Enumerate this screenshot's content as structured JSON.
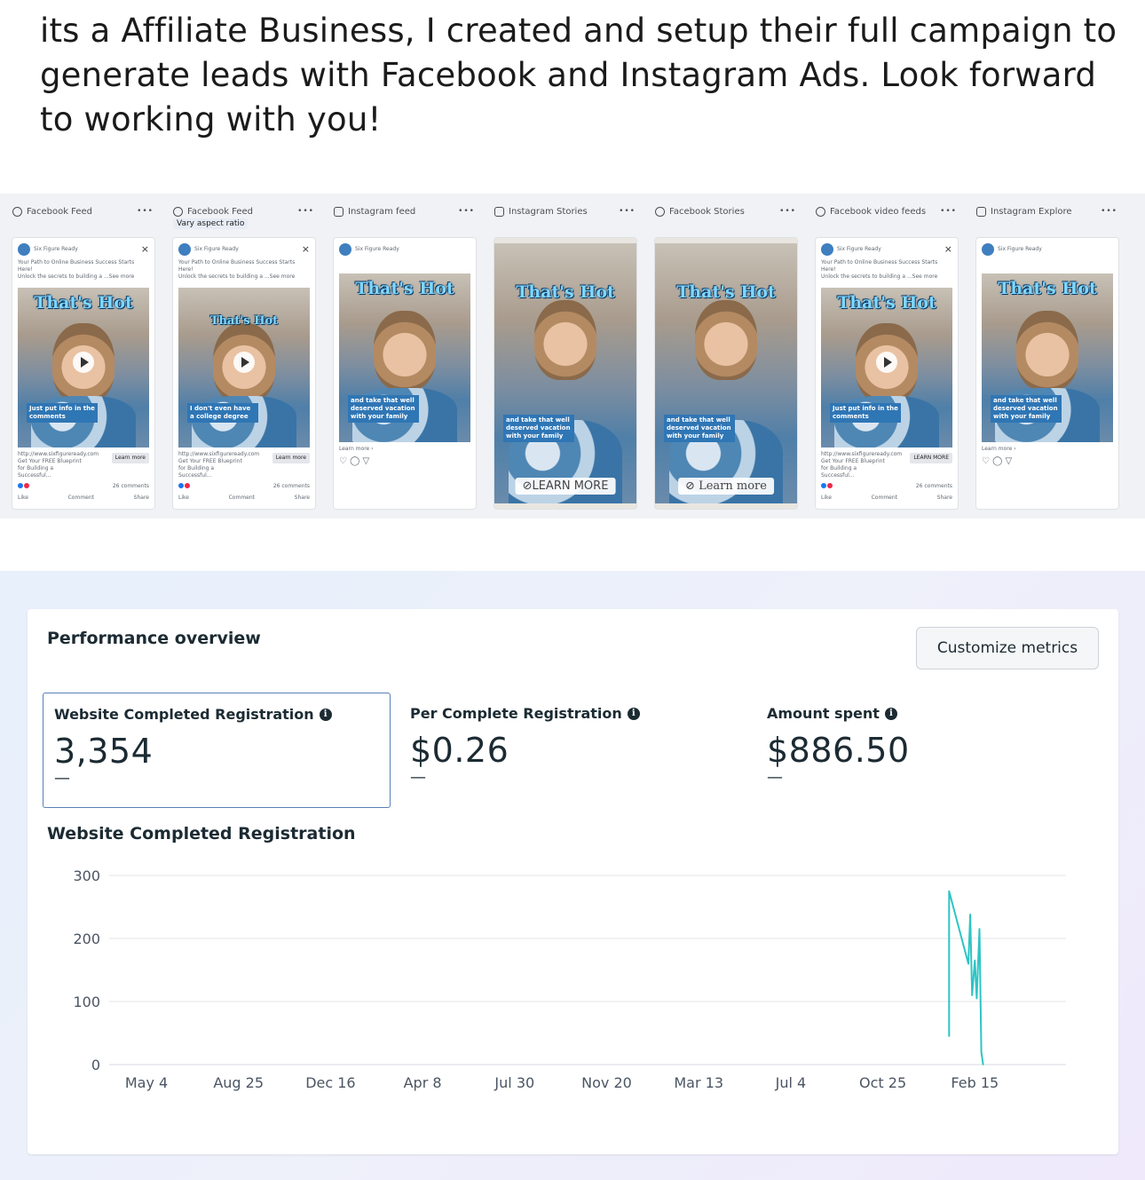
{
  "intro": {
    "text": "its a Affiliate Business, I created and setup their full campaign to generate leads with Facebook and Instagram Ads. Look forward to working with you!"
  },
  "placements": [
    {
      "label": "Facebook Feed",
      "icon": "facebook-icon",
      "sub": "",
      "headline": "That's Hot",
      "caption": "Just put info in the comments",
      "cta": "Learn more"
    },
    {
      "label": "Facebook Feed",
      "icon": "facebook-icon",
      "sub": "Vary aspect ratio",
      "headline": "That's Hot",
      "caption": "I don't even have a college degree",
      "cta": "Learn more"
    },
    {
      "label": "Instagram feed",
      "icon": "instagram-icon",
      "sub": "",
      "headline": "That's Hot",
      "caption": "and take that well deserved vacation with your family",
      "cta": "Learn more"
    },
    {
      "label": "Instagram Stories",
      "icon": "instagram-icon",
      "sub": "",
      "headline": "That's Hot",
      "caption": "and take that well deserved vacation with your family",
      "cta": "LEARN MORE"
    },
    {
      "label": "Facebook Stories",
      "icon": "facebook-icon",
      "sub": "",
      "headline": "That's Hot",
      "caption": "and take that well deserved vacation with your family",
      "cta": "Learn more"
    },
    {
      "label": "Facebook video feeds",
      "icon": "facebook-icon",
      "sub": "",
      "headline": "That's Hot",
      "caption": "Just put info in the comments",
      "cta": "LEARN MORE"
    },
    {
      "label": "Instagram Explore",
      "icon": "instagram-icon",
      "sub": "",
      "headline": "That's Hot",
      "caption": "and take that well deserved vacation with your family",
      "cta": "Learn more"
    }
  ],
  "ad": {
    "page_name": "Six Figure Ready",
    "sponsored": "Sponsored",
    "primary_text": "Your Path to Online Business Success Starts Here!",
    "secondary_text": "Unlock the secrets to building a",
    "see_more": "...See more",
    "link_url": "http://www.sixfigureready.com",
    "link_title": "Get Your FREE Blueprint for Building a Successful...",
    "comments": "26 comments",
    "like": "Like",
    "comment": "Comment",
    "share": "Share"
  },
  "performance": {
    "title": "Performance overview",
    "customize_label": "Customize metrics",
    "metrics": [
      {
        "label": "Website Completed Registration",
        "value": "3,354",
        "delta": "—"
      },
      {
        "label": "Per Complete Registration",
        "value": "$0.26",
        "delta": "—"
      },
      {
        "label": "Amount spent",
        "value": "$886.50",
        "delta": "—"
      }
    ],
    "chart_title": "Website Completed Registration"
  },
  "colors": {
    "line": "#2fc4c4",
    "selected_border": "#5a7fb8",
    "gridline": "#e4e6eb"
  },
  "chart_data": {
    "type": "line",
    "title": "Website Completed Registration",
    "xlabel": "",
    "ylabel": "",
    "ylim": [
      0,
      300
    ],
    "yticks": [
      0,
      100,
      200,
      300
    ],
    "xticks": [
      "May 4",
      "Aug 25",
      "Dec 16",
      "Apr 8",
      "Jul 30",
      "Nov 20",
      "Mar 13",
      "Jul 4",
      "Oct 25",
      "Feb 15"
    ],
    "grid": true,
    "series": [
      {
        "x_index": [
          8.72,
          8.72,
          8.93,
          8.95,
          8.97,
          9.0,
          9.02,
          9.05,
          9.07,
          9.09
        ],
        "values": [
          45,
          275,
          160,
          238,
          110,
          165,
          105,
          215,
          20,
          0
        ]
      }
    ]
  }
}
